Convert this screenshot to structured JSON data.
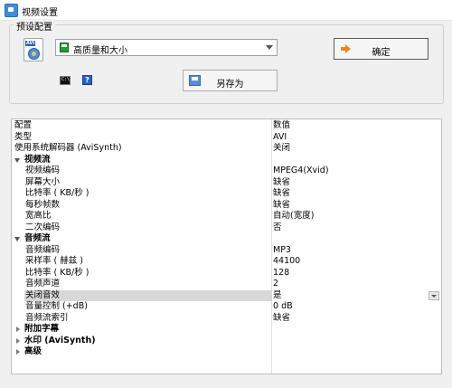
{
  "window": {
    "title": "视频设置"
  },
  "presets": {
    "group_label": "预设配置",
    "selected": "高质量和大小",
    "ok_label": "确定",
    "save_as_label": "另存为"
  },
  "grid": {
    "header": {
      "name": "配置",
      "value": "数值"
    },
    "rows": [
      {
        "name": "类型",
        "value": "AVI",
        "kind": "top"
      },
      {
        "name": "使用系统解码器 (AviSynth)",
        "value": "关闭",
        "kind": "top"
      },
      {
        "name": "视频流",
        "value": "",
        "kind": "category",
        "expanded": true
      },
      {
        "name": "视频编码",
        "value": "MPEG4(Xvid)",
        "kind": "item"
      },
      {
        "name": "屏幕大小",
        "value": "缺省",
        "kind": "item"
      },
      {
        "name": "比特率 ( KB/秒 )",
        "value": "缺省",
        "kind": "item"
      },
      {
        "name": "每秒帧数",
        "value": "缺省",
        "kind": "item"
      },
      {
        "name": "宽高比",
        "value": "自动(宽度)",
        "kind": "item"
      },
      {
        "name": "二次编码",
        "value": "否",
        "kind": "item"
      },
      {
        "name": "音频流",
        "value": "",
        "kind": "category",
        "expanded": true
      },
      {
        "name": "音频编码",
        "value": "MP3",
        "kind": "item"
      },
      {
        "name": "采样率 ( 赫兹 )",
        "value": "44100",
        "kind": "item"
      },
      {
        "name": "比特率 ( KB/秒 )",
        "value": "128",
        "kind": "item"
      },
      {
        "name": "音频声道",
        "value": "2",
        "kind": "item"
      },
      {
        "name": "关闭音效",
        "value": "是",
        "kind": "item",
        "selected": true
      },
      {
        "name": "音量控制 (+dB)",
        "value": "0 dB",
        "kind": "item"
      },
      {
        "name": "音频流索引",
        "value": "缺省",
        "kind": "item"
      },
      {
        "name": "附加字幕",
        "value": "",
        "kind": "category",
        "expanded": false
      },
      {
        "name": "水印 (AviSynth)",
        "value": "",
        "kind": "category",
        "expanded": false
      },
      {
        "name": "高级",
        "value": "",
        "kind": "category",
        "expanded": false
      }
    ]
  },
  "icons": {
    "app": "app-icon",
    "avi": "avi-file-icon",
    "preset": "floppy-disk-icon",
    "ok": "arrow-right-icon",
    "save_as": "save-icon",
    "cmd": "command-prompt-icon",
    "help": "help-icon"
  },
  "colors": {
    "window_bg": "#f0f0f0",
    "grid_bg": "#ffffff",
    "selected_row": "#d8d8d8",
    "ok_arrow": "#e08a1e",
    "help_blue": "#2a63c7"
  }
}
